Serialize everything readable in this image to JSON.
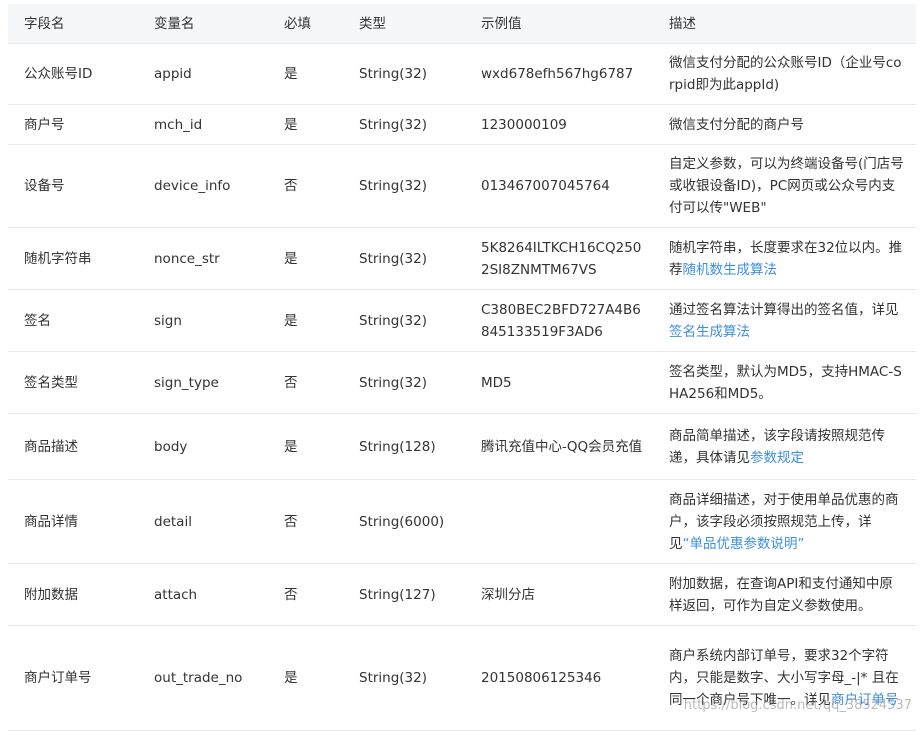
{
  "headers": [
    "字段名",
    "变量名",
    "必填",
    "类型",
    "示例值",
    "描述"
  ],
  "rows": [
    {
      "field": "公众账号ID",
      "var": "appid",
      "req": "是",
      "type": "String(32)",
      "example": "wxd678efh567hg6787",
      "desc": "微信支付分配的公众账号ID（企业号corpid即为此appId)"
    },
    {
      "field": "商户号",
      "var": "mch_id",
      "req": "是",
      "type": "String(32)",
      "example": "1230000109",
      "desc": "微信支付分配的商户号"
    },
    {
      "field": "设备号",
      "var": "device_info",
      "req": "否",
      "type": "String(32)",
      "example": "013467007045764",
      "desc": "自定义参数，可以为终端设备号(门店号或收银设备ID)，PC网页或公众号内支付可以传\"WEB\""
    },
    {
      "field": "随机字符串",
      "var": "nonce_str",
      "req": "是",
      "type": "String(32)",
      "example": "5K8264ILTKCH16CQ2502SI8ZNMTM67VS",
      "desc": "随机字符串，长度要求在32位以内。推荐",
      "desc_link": "随机数生成算法"
    },
    {
      "field": "签名",
      "var": "sign",
      "req": "是",
      "type": "String(32)",
      "example": "C380BEC2BFD727A4B6845133519F3AD6",
      "desc": "通过签名算法计算得出的签名值，详见",
      "desc_link": "签名生成算法"
    },
    {
      "field": "签名类型",
      "var": "sign_type",
      "req": "否",
      "type": "String(32)",
      "example": "MD5",
      "desc": "签名类型，默认为MD5，支持HMAC-SHA256和MD5。"
    },
    {
      "field": "商品描述",
      "var": "body",
      "req": "是",
      "type": "String(128)",
      "example": "腾讯充值中心-QQ会员充值",
      "desc": "商品简单描述，该字段请按照规范传递，具体请见",
      "desc_link": "参数规定"
    },
    {
      "field": "商品详情",
      "var": "detail",
      "req": "否",
      "type": "String(6000)",
      "example": "",
      "desc": "商品详细描述，对于使用单品优惠的商户，该字段必须按照规范上传，详见",
      "desc_link": "“单品优惠参数说明”"
    },
    {
      "field": "附加数据",
      "var": "attach",
      "req": "否",
      "type": "String(127)",
      "example": "深圳分店",
      "desc": "附加数据，在查询API和支付通知中原样返回，可作为自定义参数使用。"
    },
    {
      "field": "商户订单号",
      "var": "out_trade_no",
      "req": "是",
      "type": "String(32)",
      "example": "20150806125346",
      "desc": "商户系统内部订单号，要求32个字符内，只能是数字、大小写字母_-|* 且在同一个商户号下唯一。详见",
      "desc_link": "商户订单号"
    }
  ],
  "watermark": "https://blog.csdn.net/qq_38524537",
  "colors": {
    "link": "#3d8fe0",
    "header_bg": "#f6f7f9",
    "border": "#e8e8e8"
  }
}
